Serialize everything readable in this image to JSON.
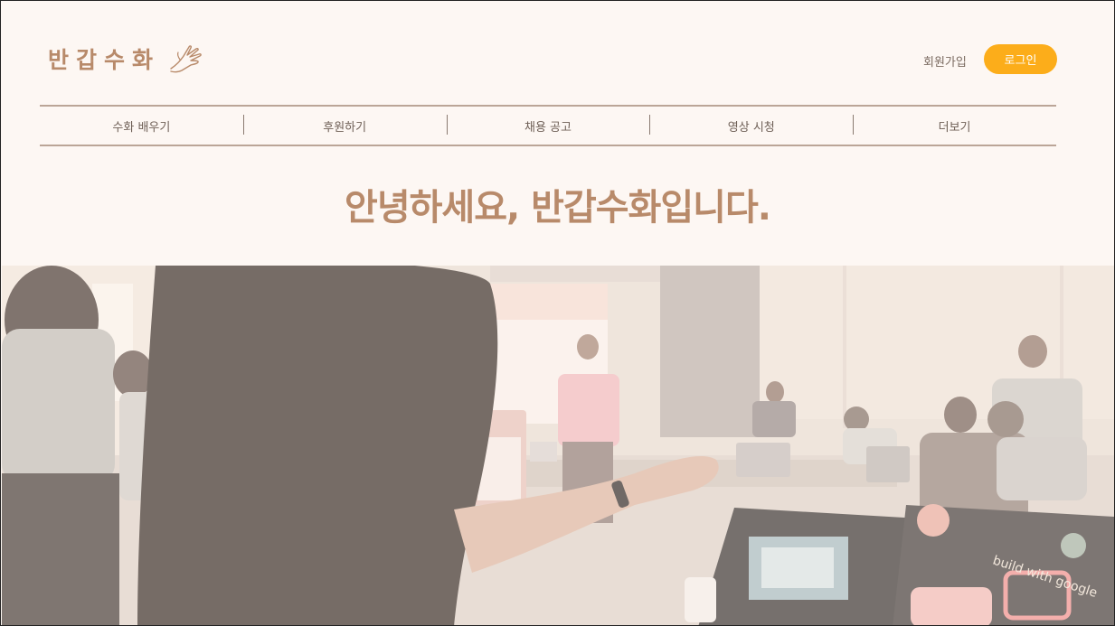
{
  "header": {
    "logo_text": "반갑수화",
    "signup_label": "회원가입",
    "login_label": "로그인"
  },
  "nav": {
    "items": [
      {
        "label": "수화 배우기"
      },
      {
        "label": "후원하기"
      },
      {
        "label": "채용 공고"
      },
      {
        "label": "영상 시청"
      },
      {
        "label": "더보기"
      }
    ]
  },
  "hero": {
    "title": "안녕하세요, 반갑수화입니다."
  },
  "colors": {
    "background": "#fdf7f3",
    "brand": "#b88a6a",
    "accent": "#fcad1a",
    "divider": "#bba597"
  },
  "photo": {
    "laptop_sticker_text": "build with google"
  }
}
